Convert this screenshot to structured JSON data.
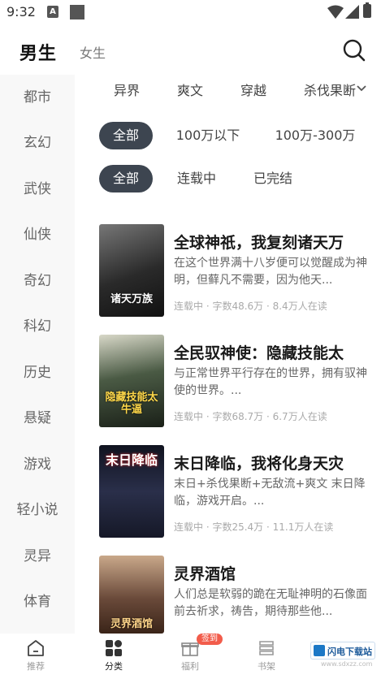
{
  "status_bar": {
    "time": "9:32",
    "a_icon": "A"
  },
  "header": {
    "tab_male": "男生",
    "tab_female": "女生",
    "search_icon": "search-icon"
  },
  "sidebar": {
    "items": [
      "都市",
      "玄幻",
      "武侠",
      "仙侠",
      "奇幻",
      "科幻",
      "历史",
      "悬疑",
      "游戏",
      "轻小说",
      "灵异",
      "体育"
    ]
  },
  "top_tags": [
    "异界",
    "爽文",
    "穿越",
    "杀伐果断"
  ],
  "filters": {
    "scope": {
      "options": [
        "全部",
        "100万以下",
        "100万-300万"
      ],
      "selected": "全部"
    },
    "status": {
      "options": [
        "全部",
        "连载中",
        "已完结"
      ],
      "selected": "全部"
    }
  },
  "books": [
    {
      "title": "全球神祇，我复刻诸天万",
      "desc": "在这个世界满十八岁便可以觉醒成为神明，但藓凡不需要，因为他天...",
      "meta": "连载中 · 字数48.6万 · 8.4万人在读",
      "cover_text": "诸天万族",
      "cover_color": "#3a3a3a"
    },
    {
      "title": "全民驭神使：隐藏技能太",
      "desc": "与正常世界平行存在的世界，拥有驭神使的世界。...",
      "meta": "连载中 · 字数68.7万 · 6.7万人在读",
      "cover_text": "隐藏技能太牛逼",
      "cover_color": "#2e3a2c"
    },
    {
      "title": "末日降临，我将化身天灾",
      "desc": "末日+杀伐果断+无敌流+爽文 末日降临，游戏开启。...",
      "meta": "连载中 · 字数25.4万 · 11.1万人在读",
      "cover_text": "末日降临",
      "cover_color": "#1d2233"
    },
    {
      "title": "灵界酒馆",
      "desc": "人们总是软弱的跪在无耻神明的石像面前去祈求，祷告，期待那些他...",
      "meta": "",
      "cover_text": "灵界酒馆",
      "cover_color": "#6a4a3a"
    }
  ],
  "bottom_nav": {
    "items": [
      {
        "label": "推荐",
        "icon": "home-icon"
      },
      {
        "label": "分类",
        "icon": "category-icon"
      },
      {
        "label": "福利",
        "icon": "gift-icon"
      },
      {
        "label": "书架",
        "icon": "bookshelf-icon"
      }
    ],
    "badge": "签到",
    "active": "分类"
  },
  "watermark": {
    "text": "闪电下载站",
    "sub": "www.sdxzz.com"
  }
}
